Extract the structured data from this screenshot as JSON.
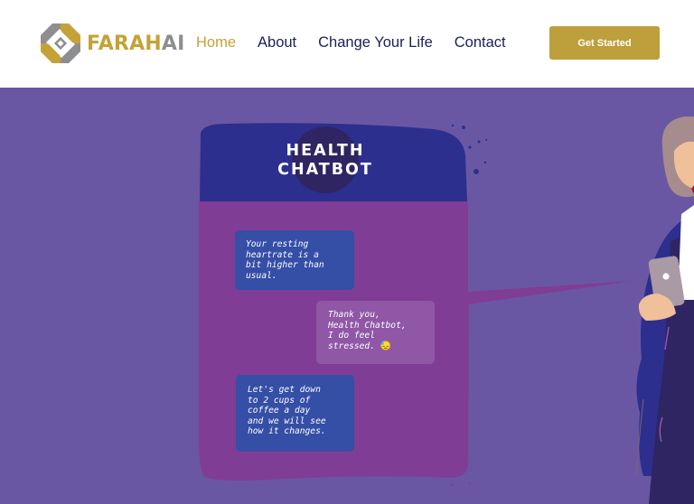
{
  "header": {
    "logo": {
      "brand_gold": "FARAH",
      "brand_gray": "AI",
      "icon": "farahai-logo-icon"
    },
    "nav": [
      {
        "label": "Home",
        "active": true
      },
      {
        "label": "About",
        "active": false
      },
      {
        "label": "Change Your Life",
        "active": false
      },
      {
        "label": "Contact",
        "active": false
      }
    ],
    "cta_label": "Get Started"
  },
  "hero": {
    "chat_title_line1": "HEALTH",
    "chat_title_line2": "CHATBOT",
    "messages": [
      {
        "sender": "bot",
        "text": "Your resting\nheartrate is a\nbit higher than\nusual."
      },
      {
        "sender": "user",
        "text": "Thank you,\nHealth Chatbot,\nI do feel\nstressed.",
        "emoji": "😓"
      },
      {
        "sender": "bot",
        "text": "Let's get down\nto 2 cups of\ncoffee a day\nand we will see\nhow it changes."
      }
    ]
  },
  "colors": {
    "brand_gold": "#c4a237",
    "brand_gray": "#8e8e91",
    "nav_text": "#1c1f57",
    "cta_bg": "#bd9f3b",
    "hero_bg": "#6a57a3",
    "chat_header": "#2d2f8f",
    "chat_body": "#803d96",
    "bot_bubble": "#354ea6",
    "user_bubble": "#8f57a6"
  }
}
